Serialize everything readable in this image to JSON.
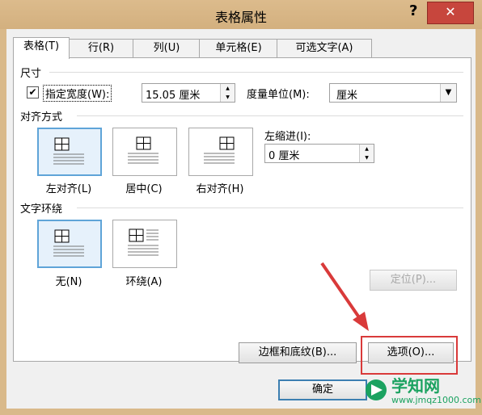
{
  "window": {
    "title": "表格属性",
    "help_label": "?",
    "close_label": "✕"
  },
  "tabs": [
    {
      "label": "表格(T)",
      "active": true
    },
    {
      "label": "行(R)"
    },
    {
      "label": "列(U)"
    },
    {
      "label": "单元格(E)"
    },
    {
      "label": "可选文字(A)"
    }
  ],
  "size": {
    "section_label": "尺寸",
    "specify_width_checked": true,
    "specify_width_label": "指定宽度(W):",
    "width_value": "15.05 厘米",
    "measure_label": "度量单位(M):",
    "measure_value": "厘米"
  },
  "alignment": {
    "section_label": "对齐方式",
    "options": [
      {
        "label": "左对齐(L)",
        "selected": true
      },
      {
        "label": "居中(C)"
      },
      {
        "label": "右对齐(H)"
      }
    ],
    "indent_label": "左缩进(I):",
    "indent_value": "0 厘米"
  },
  "wrapping": {
    "section_label": "文字环绕",
    "options": [
      {
        "label": "无(N)",
        "selected": true
      },
      {
        "label": "环绕(A)"
      }
    ],
    "position_button": "定位(P)..."
  },
  "buttons": {
    "borders": "边框和底纹(B)...",
    "options": "选项(O)...",
    "ok": "确定"
  },
  "watermark": {
    "text": "学知网",
    "url": "www.jmqz1000.com"
  },
  "colors": {
    "selection": "#5fa4d8",
    "annotation": "#d93a3a",
    "close": "#c7463d"
  }
}
